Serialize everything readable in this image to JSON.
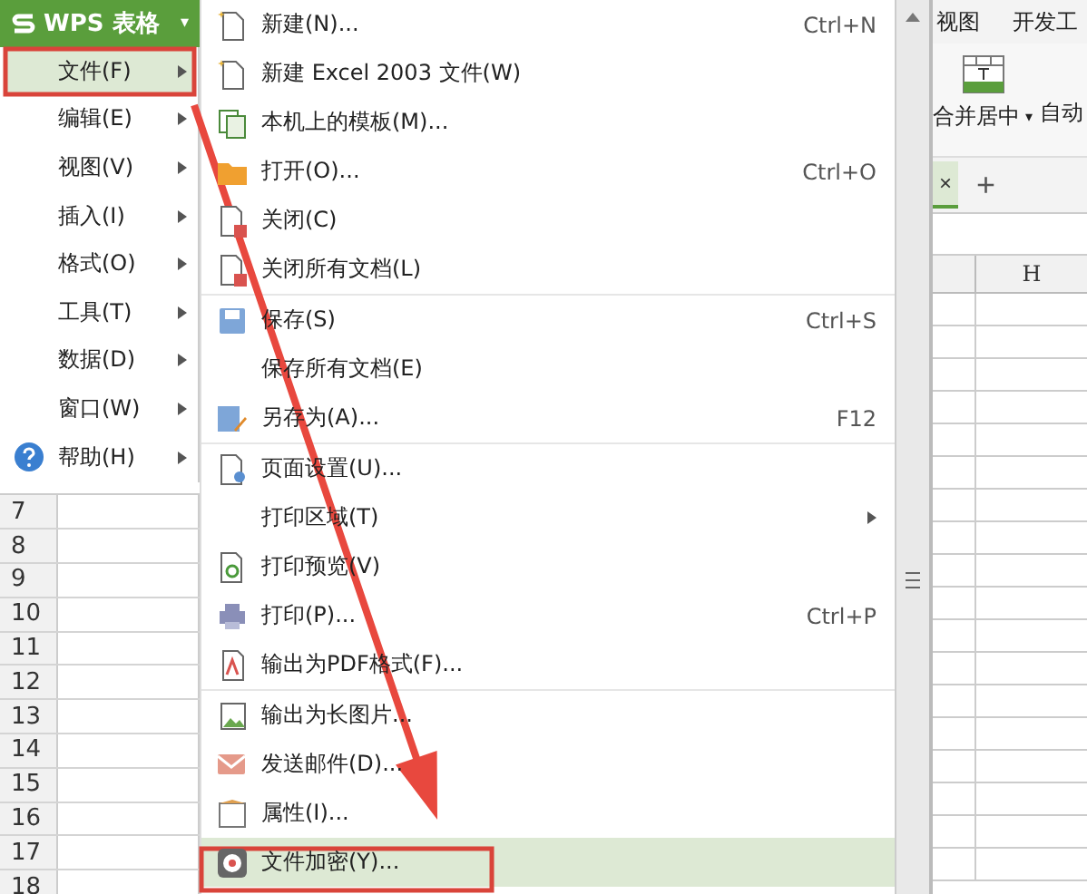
{
  "app_button": {
    "label": "WPS 表格",
    "caret": "▾"
  },
  "main_menu": [
    {
      "label": "文件(F)",
      "selected": true,
      "submenu": true
    },
    {
      "label": "编辑(E)",
      "selected": false,
      "submenu": true
    },
    {
      "label": "视图(V)",
      "selected": false,
      "submenu": true
    },
    {
      "label": "插入(I)",
      "selected": false,
      "submenu": true
    },
    {
      "label": "格式(O)",
      "selected": false,
      "submenu": true
    },
    {
      "label": "工具(T)",
      "selected": false,
      "submenu": true
    },
    {
      "label": "数据(D)",
      "selected": false,
      "submenu": true
    },
    {
      "label": "窗口(W)",
      "selected": false,
      "submenu": true
    },
    {
      "label": "帮助(H)",
      "selected": false,
      "submenu": true
    }
  ],
  "file_menu": [
    {
      "kind": "item",
      "label": "新建(N)...",
      "shortcut": "Ctrl+N",
      "selected": false,
      "submenu": false
    },
    {
      "kind": "item",
      "label": "新建 Excel 2003 文件(W)",
      "selected": false,
      "submenu": false
    },
    {
      "kind": "item",
      "label": "本机上的模板(M)...",
      "selected": false,
      "submenu": false
    },
    {
      "kind": "item",
      "label": "打开(O)...",
      "shortcut": "Ctrl+O",
      "selected": false,
      "submenu": false
    },
    {
      "kind": "item",
      "label": "关闭(C)",
      "selected": false,
      "submenu": false
    },
    {
      "kind": "item",
      "label": "关闭所有文档(L)",
      "selected": false,
      "submenu": false
    },
    {
      "kind": "separator"
    },
    {
      "kind": "item",
      "label": "保存(S)",
      "shortcut": "Ctrl+S",
      "selected": false,
      "submenu": false
    },
    {
      "kind": "item",
      "label": "保存所有文档(E)",
      "selected": false,
      "submenu": false
    },
    {
      "kind": "item",
      "label": "另存为(A)...",
      "shortcut": "F12",
      "selected": false,
      "submenu": false
    },
    {
      "kind": "separator"
    },
    {
      "kind": "item",
      "label": "页面设置(U)...",
      "selected": false,
      "submenu": false
    },
    {
      "kind": "item",
      "label": "打印区域(T)",
      "selected": false,
      "submenu": true
    },
    {
      "kind": "item",
      "label": "打印预览(V)",
      "selected": false,
      "submenu": false
    },
    {
      "kind": "item",
      "label": "打印(P)...",
      "shortcut": "Ctrl+P",
      "selected": false,
      "submenu": false
    },
    {
      "kind": "item",
      "label": "输出为PDF格式(F)...",
      "selected": false,
      "submenu": false
    },
    {
      "kind": "separator"
    },
    {
      "kind": "item",
      "label": "输出为长图片...",
      "selected": false,
      "submenu": false
    },
    {
      "kind": "item",
      "label": "发送邮件(D)...",
      "selected": false,
      "submenu": false
    },
    {
      "kind": "item",
      "label": "属性(I)...",
      "selected": false,
      "submenu": false
    },
    {
      "kind": "item",
      "label": "文件加密(Y)...",
      "selected": true,
      "submenu": false
    }
  ],
  "ribbon_tabs": [
    "视图",
    "开发工"
  ],
  "toolbar": {
    "merge_label": "合并居中",
    "merge_caret": "▾",
    "next_label": "自动"
  },
  "sheet_tab": {
    "close": "×",
    "add": "+"
  },
  "column_header": "H",
  "row_numbers": [
    "7",
    "8",
    "9",
    "10",
    "11",
    "12",
    "13",
    "14",
    "15",
    "16",
    "17",
    "18"
  ]
}
